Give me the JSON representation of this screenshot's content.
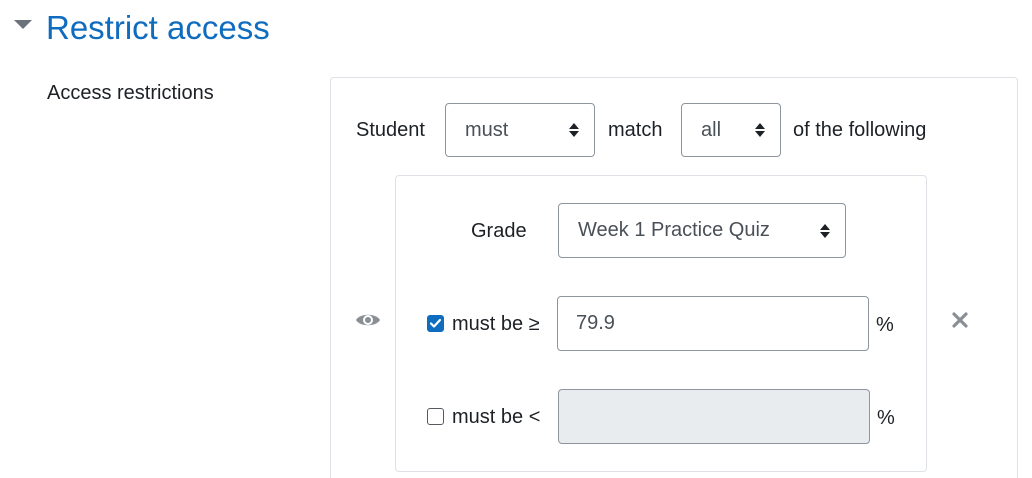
{
  "section": {
    "title": "Restrict access",
    "toggle_icon": "caret-down-icon"
  },
  "field": {
    "label": "Access restrictions"
  },
  "rule": {
    "student_label": "Student",
    "must_select": {
      "selected": "must",
      "icon": "sort-arrows-icon"
    },
    "match_label": "match",
    "all_select": {
      "selected": "all",
      "icon": "sort-arrows-icon"
    },
    "of_following_label": "of the following"
  },
  "condition": {
    "eye_icon": "eye-icon",
    "grade_label": "Grade",
    "grade_item_select": {
      "selected": "Week 1 Practice Quiz",
      "icon": "sort-arrows-icon"
    },
    "min": {
      "checked": true,
      "label": "must be ≥",
      "value": "79.9",
      "unit": "%"
    },
    "max": {
      "checked": false,
      "label": "must be <",
      "value": "",
      "unit": "%"
    },
    "delete_icon": "close-icon"
  },
  "colors": {
    "accent": "#0f6cbf",
    "text": "#1d2125",
    "muted_icon": "#8a8f96",
    "border": "#dee2e6",
    "disabled_bg": "#e9ecef"
  }
}
